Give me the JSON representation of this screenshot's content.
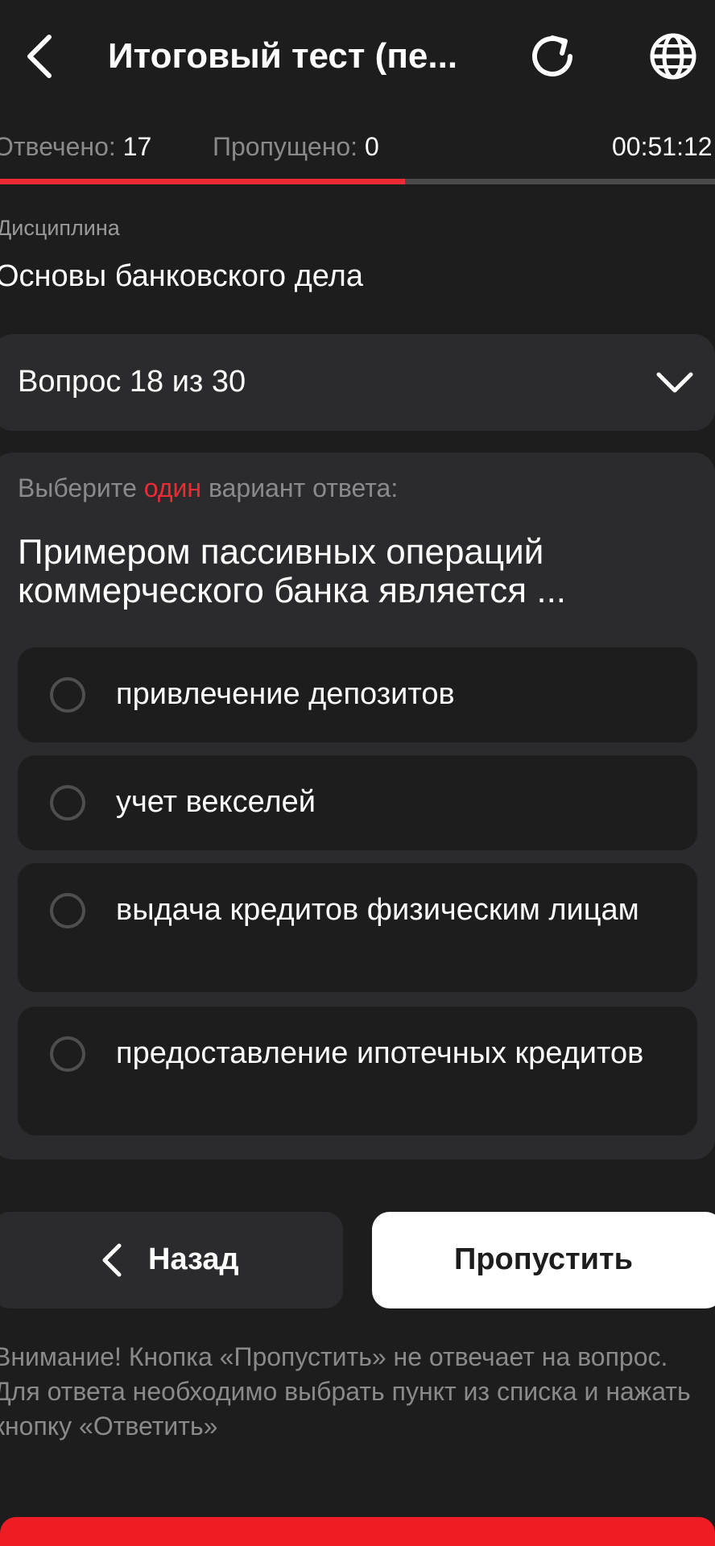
{
  "header": {
    "title": "Итоговый тест (пе..."
  },
  "stats": {
    "answered_label": "Отвечено:",
    "answered_value": "17",
    "skipped_label": "Пропущено:",
    "skipped_value": "0",
    "timer": "00:51:12"
  },
  "progress": {
    "fraction": 0.5667
  },
  "discipline": {
    "label": "Дисциплина",
    "value": "Основы банковского дела"
  },
  "question_selector": {
    "label": "Вопрос 18 из 30"
  },
  "question": {
    "instruction_pre": "Выберите",
    "instruction_accent": "один",
    "instruction_post": "вариант ответа:",
    "text": "Примером пассивных операций коммерческого банка является ...",
    "options": [
      {
        "label": "привлечение депозитов"
      },
      {
        "label": "учет векселей"
      },
      {
        "label": "выдача кредитов физическим лицам"
      },
      {
        "label": "предоставление ипотечных кредитов"
      }
    ]
  },
  "buttons": {
    "back_label": "Назад",
    "skip_label": "Пропустить"
  },
  "warning": "Внимание! Кнопка «Пропустить» не отвечает на вопрос. Для ответа необходимо выбрать пункт из списка и нажать кнопку «Ответить»",
  "colors": {
    "accent": "#ee2a35",
    "background": "#1d1d1e",
    "card": "#2b2b2d"
  },
  "icons": {
    "back": "chevron-left-icon",
    "refresh": "refresh-icon",
    "language": "globe-icon",
    "expand": "chevron-down-icon"
  }
}
